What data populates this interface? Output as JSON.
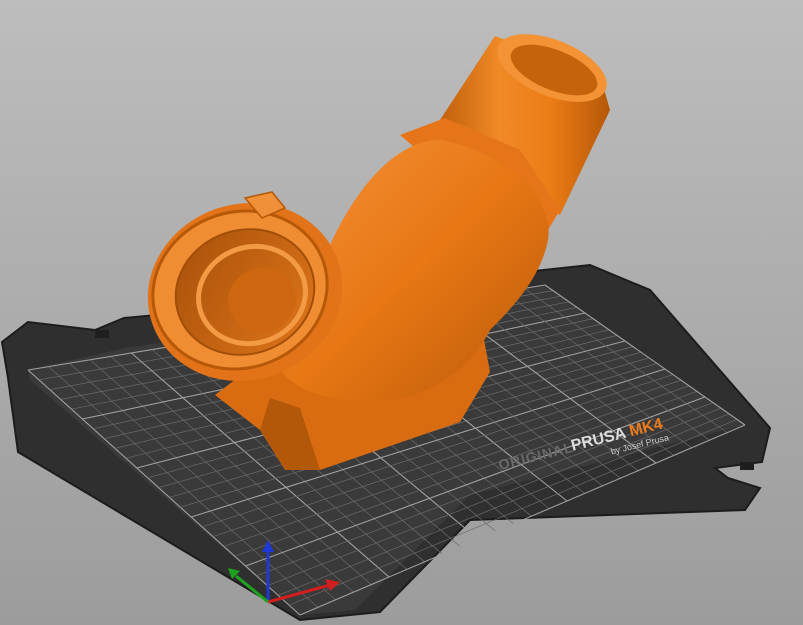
{
  "app": "PrusaSlicer 3D view",
  "bed": {
    "brand_original": "ORIGINAL",
    "brand_prusa": "PRUSA",
    "brand_model": "MK4",
    "byline": "by Josef Prusa",
    "surface_color": "#3a3a3a",
    "grid_color": "#6b6b6b",
    "major_grid_color": "#a0a0a0",
    "model_color_accent": "#ee7b17"
  },
  "model": {
    "color": "#ec7c16",
    "dark_color": "#b85a0b",
    "light_color": "#f59a3c"
  },
  "axes": {
    "x_color": "#d11f1f",
    "y_color": "#1fa31f",
    "z_color": "#1f39d6"
  }
}
